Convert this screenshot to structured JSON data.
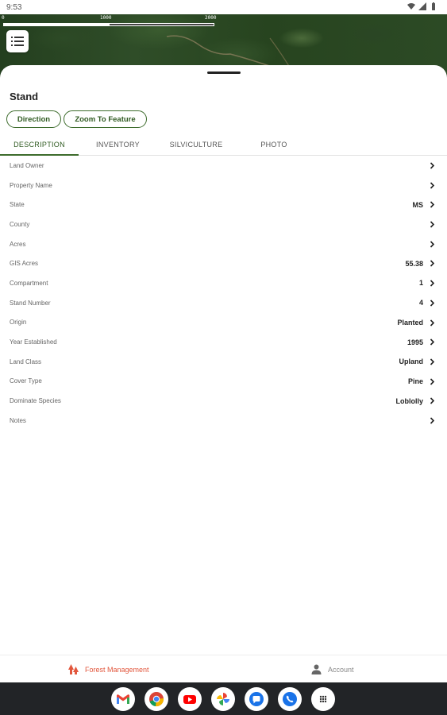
{
  "status_bar": {
    "time": "9:53"
  },
  "map": {
    "scale_labels": [
      "0",
      "1000",
      "2000"
    ]
  },
  "sheet": {
    "title": "Stand",
    "buttons": {
      "direction": "Direction",
      "zoom": "Zoom To Feature"
    },
    "tabs": [
      "DESCRIPTION",
      "INVENTORY",
      "SILVICULTURE",
      "PHOTO"
    ],
    "active_tab": "DESCRIPTION",
    "rows": [
      {
        "label": "Land Owner",
        "value": ""
      },
      {
        "label": "Property Name",
        "value": ""
      },
      {
        "label": "State",
        "value": "MS"
      },
      {
        "label": "County",
        "value": ""
      },
      {
        "label": "Acres",
        "value": ""
      },
      {
        "label": "GIS Acres",
        "value": "55.38"
      },
      {
        "label": "Compartment",
        "value": "1"
      },
      {
        "label": "Stand Number",
        "value": "4"
      },
      {
        "label": "Origin",
        "value": "Planted"
      },
      {
        "label": "Year Established",
        "value": "1995"
      },
      {
        "label": "Land Class",
        "value": "Upland"
      },
      {
        "label": "Cover Type",
        "value": "Pine"
      },
      {
        "label": "Dominate Species",
        "value": "Loblolly"
      },
      {
        "label": "Notes",
        "value": ""
      }
    ]
  },
  "bottom_nav": {
    "forest": "Forest Management",
    "account": "Account"
  },
  "colors": {
    "accent_green": "#3d6b2c",
    "nav_active": "#e2573d"
  },
  "taskbar_apps": [
    "gmail-icon",
    "chrome-icon",
    "youtube-icon",
    "photos-icon",
    "messages-icon",
    "phone-icon",
    "app-drawer-icon"
  ]
}
